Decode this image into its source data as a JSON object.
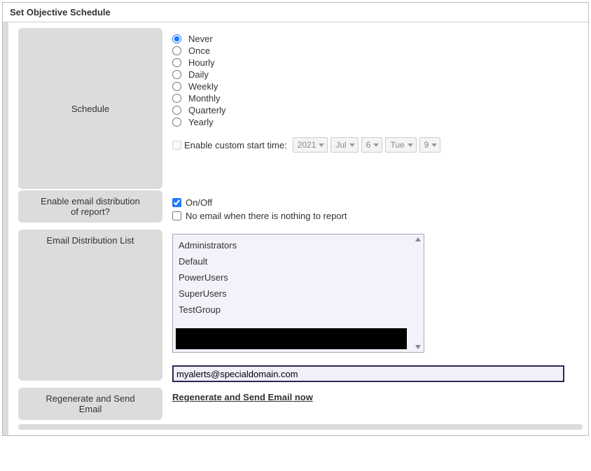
{
  "panel": {
    "title": "Set Objective Schedule"
  },
  "schedule": {
    "label": "Schedule",
    "selected": "Never",
    "options": [
      "Never",
      "Once",
      "Hourly",
      "Daily",
      "Weekly",
      "Monthly",
      "Quarterly",
      "Yearly"
    ],
    "enable_custom_label": "Enable custom start time:",
    "enable_custom_checked": false,
    "time": {
      "year": "2021",
      "month": "Jul",
      "day": "6",
      "dow": "Tue",
      "hour": "9"
    }
  },
  "enable_email": {
    "label_line1": "Enable email distribution",
    "label_line2": "of report?",
    "onoff_label": "On/Off",
    "onoff_checked": true,
    "noempty_label": "No email when there is nothing to report",
    "noempty_checked": false
  },
  "dist_list": {
    "label": "Email Distribution List",
    "items": [
      "Administrators",
      "Default",
      "PowerUsers",
      "SuperUsers",
      "TestGroup"
    ],
    "email_value": "myalerts@specialdomain.com"
  },
  "regen": {
    "label_line1": "Regenerate and Send",
    "label_line2": "Email",
    "link_text": "Regenerate and Send Email now"
  }
}
